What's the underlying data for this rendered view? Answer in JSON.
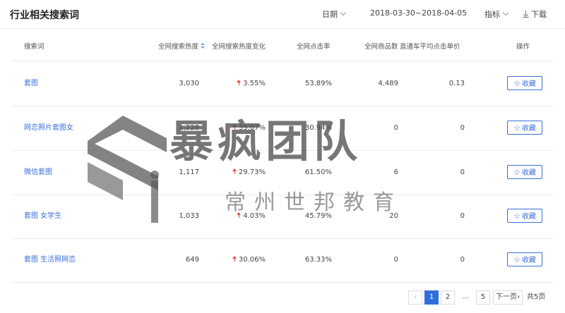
{
  "header": {
    "title": "行业相关搜索词",
    "date_label": "日期",
    "date_range": "2018-03-30~2018-04-05",
    "metric_label": "指标",
    "download_label": "下载"
  },
  "table": {
    "columns": [
      "搜索词",
      "全网搜索热度",
      "全网搜索热度变化",
      "全网点击率",
      "全网商品数",
      "直通车平均点击单价",
      "操作"
    ],
    "rows": [
      {
        "keyword": "套图",
        "heat": "3,030",
        "change": "3.55%",
        "ctr": "53.89%",
        "products": "4,489",
        "cpc": "0.13",
        "action": "收藏"
      },
      {
        "keyword": "网恋照片套图女",
        "heat": "1,228",
        "change": "39.07%",
        "ctr": "30.94%",
        "products": "0",
        "cpc": "0",
        "action": "收藏"
      },
      {
        "keyword": "微信套图",
        "heat": "1,117",
        "change": "29.73%",
        "ctr": "61.50%",
        "products": "6",
        "cpc": "0",
        "action": "收藏"
      },
      {
        "keyword": "套图 女学生",
        "heat": "1,033",
        "change": "4.03%",
        "ctr": "45.79%",
        "products": "20",
        "cpc": "0",
        "action": "收藏"
      },
      {
        "keyword": "套图 生活照网恋",
        "heat": "649",
        "change": "30.06%",
        "ctr": "63.33%",
        "products": "0",
        "cpc": "0",
        "action": "收藏"
      }
    ]
  },
  "pagination": {
    "prev": "‹",
    "pages": [
      "1",
      "2",
      "...",
      "5"
    ],
    "current": "1",
    "next": "下一页›",
    "total": "共5页"
  },
  "watermark": {
    "main": "暴疯团队",
    "sub": "常州世邦教育"
  },
  "colors": {
    "accent": "#2f6fdc",
    "link": "#3a6fd9",
    "up": "#e24a4a"
  }
}
